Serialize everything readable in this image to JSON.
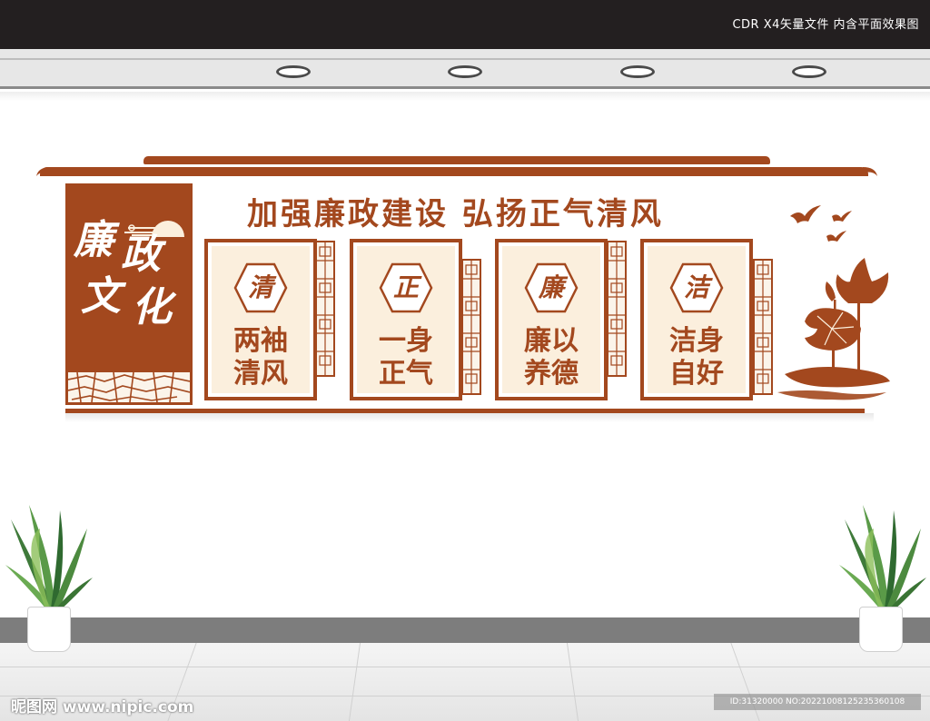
{
  "header": {
    "caption": "CDR X4矢量文件  内含平面效果图"
  },
  "wall": {
    "side_title_chars": [
      "廉",
      "政",
      "文",
      "化"
    ],
    "slogan": "加强廉政建设  弘扬正气清风",
    "cards": [
      {
        "char": "清",
        "line1": "两袖",
        "line2": "清风"
      },
      {
        "char": "正",
        "line1": "一身",
        "line2": "正气"
      },
      {
        "char": "廉",
        "line1": "廉以",
        "line2": "养德"
      },
      {
        "char": "洁",
        "line1": "洁身",
        "line2": "自好"
      }
    ]
  },
  "watermark": {
    "site": "昵图网 www.nipic.com",
    "id_text": "ID:31320000 NO:20221008125235360108"
  },
  "colors": {
    "brand_brown": "#a3481e",
    "card_bg": "#fbefdd",
    "top_bar": "#231f20"
  },
  "icons": [
    "ceiling-light-icon",
    "hexagon-badge-icon",
    "lotus-icon",
    "bird-icon",
    "cloud-icon",
    "lattice-pattern",
    "potted-plant-icon"
  ]
}
